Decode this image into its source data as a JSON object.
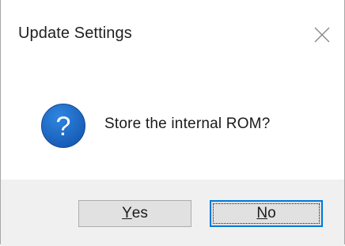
{
  "dialog": {
    "title": "Update Settings",
    "message": "Store the internal ROM?",
    "icon": "question-icon",
    "icon_color": "#1a66c2",
    "buttons": {
      "yes": {
        "mnemonic": "Y",
        "rest": "es"
      },
      "no": {
        "mnemonic": "N",
        "rest": "o",
        "focused": true
      }
    },
    "colors": {
      "footer_background": "#f0f0f0",
      "focus_border": "#0078d7",
      "button_background": "#e1e1e1"
    }
  }
}
